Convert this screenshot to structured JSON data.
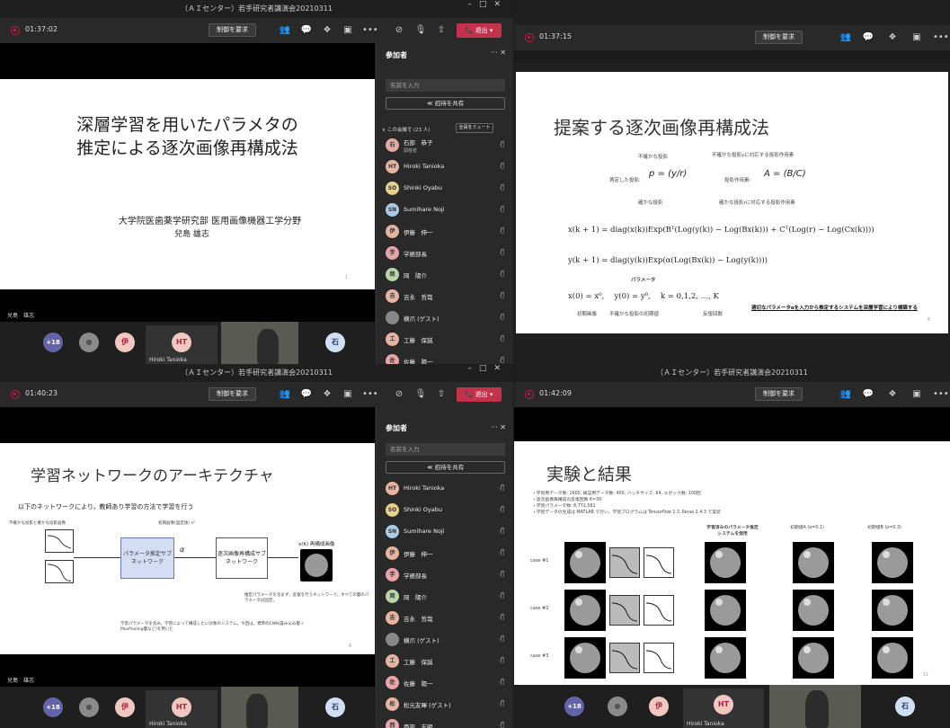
{
  "window_title": "（ＡＩセンター）若手研究者講演会20210311",
  "request_control": "制御を要求",
  "leave": "退出",
  "q1": {
    "time": "01:37:02",
    "slide_title_l1": "深層学習を用いたパラメタの",
    "slide_title_l2": "推定による逐次画像再構成法",
    "affil": "大学院医歯薬学研究部 医用画像機器工学分野",
    "presenter": "兒島 雄志",
    "page": "1",
    "presenter_label": "兒島　雄志",
    "strip_badge": "+18",
    "av_i": "伊",
    "av_ht": "HT",
    "av_ishi": "石",
    "cam_name": "Hiroki Tanioka"
  },
  "q2": {
    "time": "01:37:15",
    "slide_title": "提案する逐次画像再構成法",
    "l1": "不確かな投影",
    "l2": "測定した投影:",
    "l3": "確かな投影",
    "l4": "不確かな投影yに対応する投影作用素",
    "l5": "投影作用素:",
    "l6": "確かな投影rに対応する投影作用素",
    "eq1": "x(k + 1) = diag(x(k))Exp(Bᵀ(Log(y(k)) − Log(Bx(k))) + Cᵀ(Log(r) − Log(Cx(k))))",
    "eq2": "y(k + 1) = diag(y(k))Exp(α(Log(Bx(k)) − Log(y(k))))",
    "param": "パラメータ",
    "eq3": "x(0) = x⁰,　 y(0) = y⁰,　 k = 0,1,2, …, K",
    "c1": "初期画像",
    "c2": "不確かな投影の初期値",
    "c3": "反復回数",
    "note": "適切なパラメータαを入力から推定するシステムを深層学習により構築する",
    "page": "6"
  },
  "q3": {
    "time": "01:40:23",
    "slide_title": "学習ネットワークのアーキテクチャ",
    "intro": "以下のネットワークにより，教師あり学習の方法で学習を行う",
    "box1": "パラメータ推定サブネットワーク",
    "box2": "逐次画像再構成サブネットワーク",
    "out": "x(K) 再構成画像",
    "alpha": "α",
    "n1": "不確かな投影と確かな投影画像",
    "n2": "初期画像(固定値) x⁰",
    "n3": "学習パラメータを含み，学習によって構成したい対象のシステム。今回は，標準的CNN(畳み込み層＋MaxPooling層など)を用いた",
    "n4": "推定パラメータを含まず，反復を行うネットワーク。すべての層のパラメータは固定。",
    "page": "9",
    "presenter_label": "兒島　雄志",
    "cam_name": "Hiroki Tanioka",
    "av_ht": "HT"
  },
  "q4": {
    "time": "01:42:09",
    "slide_title": "実験と結果",
    "b1": "・学習用データ数: 1600, 検証用データ数: 400, バッチサイズ: 64, エポック数: 100回",
    "b2": "・逐次画像再構成の反復回数 K=30",
    "b3": "・学習パラメータ数: 8,772,561",
    "b4": "・学習データの生成は MATLAB で行い，学習プログラムは Tensorflow 2.3, Keras 2.4.3 で実装",
    "h1": "学習済みのパラメータ推定システムを使用",
    "h2": "初期値A (α=0.1)",
    "h3": "初期値B (α=0.3)",
    "cases": [
      "case #1",
      "case #2",
      "case #3"
    ],
    "page": "11",
    "cam_name": "Hiroki Tanioka"
  },
  "panel": {
    "title": "参加者",
    "search": "名前を入力",
    "share": "招待を共有",
    "meeting": "この会議で (23 人)",
    "muteall": "全員をミュート",
    "rows1": [
      [
        "石部　恭子",
        "開催者",
        "石",
        "#e4a9a0"
      ],
      [
        "Hiroki Tanioka",
        "",
        "HT",
        "#e8b4a0"
      ],
      [
        "Shinki Oyabu",
        "",
        "SO",
        "#e8d18a"
      ],
      [
        "Sumihare Noji",
        "",
        "SN",
        "#aacbe6"
      ],
      [
        "伊藤　伸一",
        "",
        "伊",
        "#e8b4a0"
      ],
      [
        "学務部長",
        "",
        "学",
        "#e8a5a8"
      ],
      [
        "岡　陽介",
        "",
        "岡",
        "#b9d6a8"
      ],
      [
        "吉永　哲哉",
        "",
        "吉",
        "#e8b4a0"
      ],
      [
        "横爪 (ゲスト)",
        "",
        "",
        "#888"
      ],
      [
        "工藤　保誠",
        "",
        "工",
        "#e8b4a0"
      ],
      [
        "佐藤　陽一",
        "",
        "佐",
        "#e8a5a8"
      ]
    ],
    "rows2": [
      [
        "Hiroki Tanioka",
        "",
        "HT",
        "#e8b4a0"
      ],
      [
        "Shinki Oyabu",
        "",
        "SO",
        "#e8d18a"
      ],
      [
        "Sumihare Noji",
        "",
        "SN",
        "#aacbe6"
      ],
      [
        "伊藤　伸一",
        "",
        "伊",
        "#e8b4a0"
      ],
      [
        "学務部長",
        "",
        "学",
        "#e8a5a8"
      ],
      [
        "岡　陽介",
        "",
        "岡",
        "#b9d6a8"
      ],
      [
        "吉永　哲哉",
        "",
        "吉",
        "#e8b4a0"
      ],
      [
        "横爪 (ゲスト)",
        "",
        "",
        "#888"
      ],
      [
        "工藤　保誠",
        "",
        "工",
        "#e8b4a0"
      ],
      [
        "佐藤　陽一",
        "",
        "佐",
        "#e8a5a8"
      ],
      [
        "松元友暉 (ゲスト)",
        "",
        "松",
        "#e8b4a0"
      ],
      [
        "西部　志明",
        "",
        "西",
        "#e8a5a8"
      ]
    ]
  }
}
